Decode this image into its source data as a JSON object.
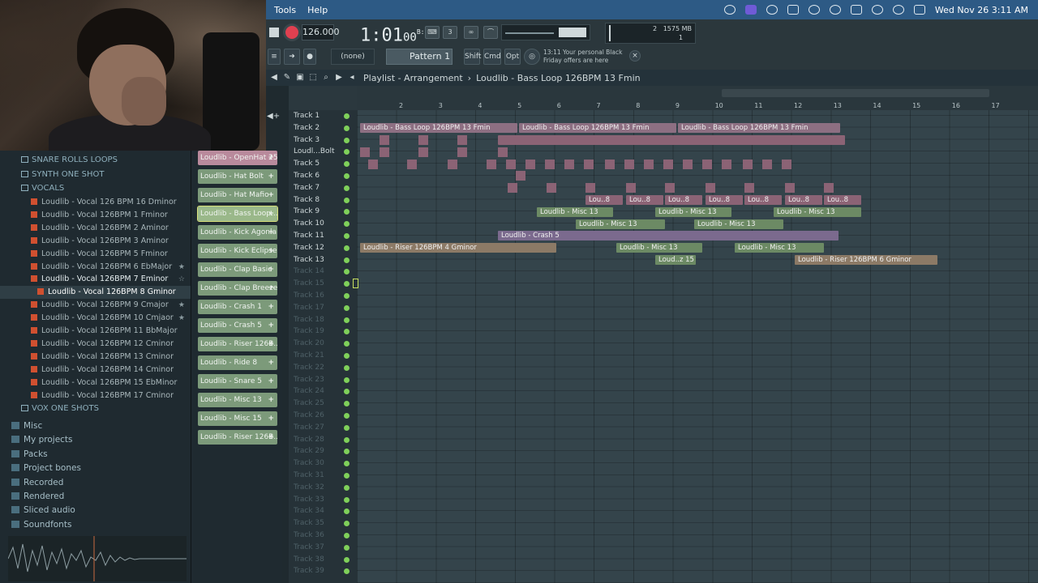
{
  "menubar": {
    "items": [
      "Tools",
      "Help"
    ],
    "datetime": "Wed Nov 26  3:11 AM"
  },
  "transport": {
    "tempo": "126.000",
    "clock": "1:01",
    "clock_small": "00",
    "clock_sup": "B:S:T",
    "memory": "1575 MB",
    "cpu_num1": "2",
    "cpu_num2": "1"
  },
  "toolbar2": {
    "none_label": "(none)",
    "pattern_label": "Pattern 1",
    "shift": "Shift",
    "cmd": "Cmd",
    "opt": "Opt",
    "news_line1": "13:11  Your personal Black",
    "news_line2": "Friday offers are here"
  },
  "playlist": {
    "title": "Playlist - Arrangement",
    "sep": "›",
    "pattern_title": "Loudlib - Bass Loop 126BPM 13 Fmin",
    "ruler_ticks": [
      "2",
      "3",
      "4",
      "5",
      "6",
      "7",
      "8",
      "9",
      "10",
      "11",
      "12",
      "13",
      "14",
      "15",
      "16",
      "17"
    ]
  },
  "browser": {
    "folders_top": [
      "SNARE ROLLS LOOPS",
      "SYNTH ONE SHOT",
      "VOCALS"
    ],
    "vocal_files": [
      {
        "name": "Loudlib - Vocal 126 BPM 16 Dminor",
        "star": ""
      },
      {
        "name": "Loudlib - Vocal 126BPM 1 Fminor",
        "star": ""
      },
      {
        "name": "Loudlib - Vocal 126BPM 2 Aminor",
        "star": ""
      },
      {
        "name": "Loudlib - Vocal 126BPM 3 Aminor",
        "star": ""
      },
      {
        "name": "Loudlib - Vocal 126BPM 5 Fminor",
        "star": ""
      },
      {
        "name": "Loudlib - Vocal 126BPM 6 EbMajor",
        "star": "★"
      },
      {
        "name": "Loudlib - Vocal 126BPM 7 Eminor",
        "star": "☆"
      },
      {
        "name": "Loudlib - Vocal 126BPM 8 Gminor",
        "star": ""
      },
      {
        "name": "Loudlib - Vocal 126BPM 9 Cmajor",
        "star": "★"
      },
      {
        "name": "Loudlib - Vocal 126BPM 10 Cmjaor",
        "star": "★"
      },
      {
        "name": "Loudlib - Vocal 126BPM 11 BbMajor",
        "star": ""
      },
      {
        "name": "Loudlib - Vocal 126BPM 12 Cminor",
        "star": ""
      },
      {
        "name": "Loudlib - Vocal 126BPM 13 Cminor",
        "star": ""
      },
      {
        "name": "Loudlib - Vocal 126BPM 14 Cminor",
        "star": ""
      },
      {
        "name": "Loudlib - Vocal 126BPM 15 EbMinor",
        "star": ""
      },
      {
        "name": "Loudlib - Vocal 126BPM 17 Cminor",
        "star": ""
      }
    ],
    "vox_folder": "VOX ONE SHOTS",
    "roots": [
      "Misc",
      "My projects",
      "Packs",
      "Project bones",
      "Recorded",
      "Rendered",
      "Sliced audio",
      "Soundfonts"
    ]
  },
  "channels": [
    {
      "name": "Loudlib - OpenHat 25",
      "color": "pink"
    },
    {
      "name": "Loudlib - Hat Bolt",
      "color": "green"
    },
    {
      "name": "Loudlib - Hat Mafio",
      "color": "green"
    },
    {
      "name": "Loudlib - Bass Loop...",
      "color": "active"
    },
    {
      "name": "Loudlib - Kick Agonia",
      "color": "green"
    },
    {
      "name": "Loudlib - Kick Eclipse",
      "color": "green"
    },
    {
      "name": "Loudlib - Clap Basic",
      "color": "green"
    },
    {
      "name": "Loudlib - Clap Breeze",
      "color": "green"
    },
    {
      "name": "Loudlib - Crash 1",
      "color": "green"
    },
    {
      "name": "Loudlib - Crash 5",
      "color": "green"
    },
    {
      "name": "Loudlib - Riser 126B...",
      "color": "green"
    },
    {
      "name": "Loudlib - Ride 8",
      "color": "green"
    },
    {
      "name": "Loudlib - Snare 5",
      "color": "green"
    },
    {
      "name": "Loudlib - Misc 13",
      "color": "green"
    },
    {
      "name": "Loudlib - Misc 15",
      "color": "green"
    },
    {
      "name": "Loudlib - Riser 126B...",
      "color": "green"
    }
  ],
  "tracks": [
    "Track 1",
    "Track 2",
    "Track 3",
    "Loudl...Bolt",
    "Track 5",
    "Track 6",
    "Track 7",
    "Track 8",
    "Track 9",
    "Track 10",
    "Track 11",
    "Track 12",
    "Track 13",
    "Track 14",
    "Track 15",
    "Track 16",
    "Track 17",
    "Track 18",
    "Track 19",
    "Track 20",
    "Track 21",
    "Track 22",
    "Track 23",
    "Track 24",
    "Track 25",
    "Track 26",
    "Track 27",
    "Track 28",
    "Track 29",
    "Track 30",
    "Track 31",
    "Track 32",
    "Track 33",
    "Track 34",
    "Track 35",
    "Track 36",
    "Track 37",
    "Track 38",
    "Track 39"
  ],
  "clips": {
    "bass": "Loudlib - Bass Loop 126BPM 13 Fmin",
    "misc13": "Loudlib - Misc 13",
    "crash5": "Loudlib - Crash 5",
    "riser4": "Loudlib - Riser 126BPM 4 Gminor",
    "riser6": "Loudlib - Riser 126BPM 6 Gminor",
    "lou8": "Lou..8",
    "loud15": "Loud..z 15"
  }
}
